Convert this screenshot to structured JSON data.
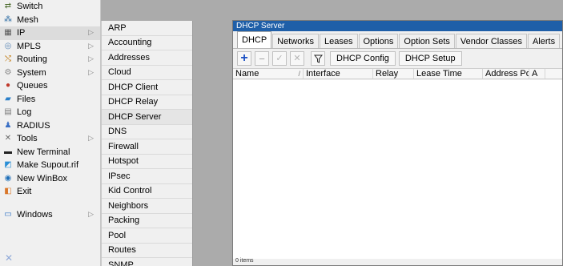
{
  "sidebar": {
    "items": [
      {
        "label": "Switch",
        "icon": "switch-icon",
        "glyph": "⇄",
        "color": "#4a6a2a",
        "arrow": false
      },
      {
        "label": "Mesh",
        "icon": "mesh-icon",
        "glyph": "⁂",
        "color": "#2e6da4",
        "arrow": false
      },
      {
        "label": "IP",
        "icon": "ip-icon",
        "glyph": "▦",
        "color": "#555555",
        "arrow": true,
        "highlight": true
      },
      {
        "label": "MPLS",
        "icon": "mpls-icon",
        "glyph": "◎",
        "color": "#5a86b5",
        "arrow": true
      },
      {
        "label": "Routing",
        "icon": "routing-icon",
        "glyph": "⤭",
        "color": "#c07a12",
        "arrow": true
      },
      {
        "label": "System",
        "icon": "system-icon",
        "glyph": "⚙",
        "color": "#8a8a8a",
        "arrow": true
      },
      {
        "label": "Queues",
        "icon": "queues-icon",
        "glyph": "●",
        "color": "#c0392b",
        "arrow": false
      },
      {
        "label": "Files",
        "icon": "files-icon",
        "glyph": "▰",
        "color": "#2a7fc9",
        "arrow": false
      },
      {
        "label": "Log",
        "icon": "log-icon",
        "glyph": "▤",
        "color": "#7a7a7a",
        "arrow": false
      },
      {
        "label": "RADIUS",
        "icon": "radius-icon",
        "glyph": "♟",
        "color": "#3a6fc4",
        "arrow": false
      },
      {
        "label": "Tools",
        "icon": "tools-icon",
        "glyph": "✕",
        "color": "#6a6a6a",
        "arrow": true
      },
      {
        "label": "New Terminal",
        "icon": "terminal-icon",
        "glyph": "▬",
        "color": "#222222",
        "arrow": false
      },
      {
        "label": "Make Supout.rif",
        "icon": "supout-icon",
        "glyph": "◩",
        "color": "#2a8fd6",
        "arrow": false
      },
      {
        "label": "New WinBox",
        "icon": "winbox-icon",
        "glyph": "◉",
        "color": "#1f6fb8",
        "arrow": false
      },
      {
        "label": "Exit",
        "icon": "exit-icon",
        "glyph": "◧",
        "color": "#d9772a",
        "arrow": false
      }
    ],
    "bottom_items": [
      {
        "label": "Windows",
        "icon": "windows-icon",
        "glyph": "▭",
        "color": "#2a6fc4",
        "arrow": true
      }
    ]
  },
  "submenu": {
    "items": [
      "ARP",
      "Accounting",
      "Addresses",
      "Cloud",
      "DHCP Client",
      "DHCP Relay",
      "DHCP Server",
      "DNS",
      "Firewall",
      "Hotspot",
      "IPsec",
      "Kid Control",
      "Neighbors",
      "Packing",
      "Pool",
      "Routes",
      "SNMP"
    ],
    "selected": "DHCP Server"
  },
  "window": {
    "title": "DHCP Server",
    "tabs": [
      "DHCP",
      "Networks",
      "Leases",
      "Options",
      "Option Sets",
      "Vendor Classes",
      "Alerts"
    ],
    "active_tab": "DHCP",
    "toolbar": {
      "dhcp_config_label": "DHCP Config",
      "dhcp_setup_label": "DHCP Setup"
    },
    "columns": [
      {
        "label": "Name",
        "width": 88,
        "sort": "/"
      },
      {
        "label": "Interface",
        "width": 87
      },
      {
        "label": "Relay",
        "width": 51
      },
      {
        "label": "Lease Time",
        "width": 86
      },
      {
        "label": "Address Pool",
        "width": 58
      },
      {
        "label": "A",
        "width": 20
      }
    ],
    "status_text": "0 items"
  },
  "colors": {
    "titlebar": "#1f5fa8",
    "highlight": "#dcdcdc",
    "background": "#ababab"
  }
}
